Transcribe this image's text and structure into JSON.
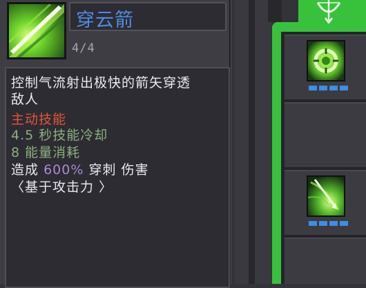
{
  "tooltip": {
    "skill_name": "穿云箭",
    "level": "4/4",
    "description_line1": "控制气流射出极快的箭矢穿透",
    "description_line2": "敌人",
    "skill_type": "主动技能",
    "cooldown": "4.5 秒技能冷却",
    "energy_cost": "8 能量消耗",
    "damage_prefix": "造成",
    "damage_value": "600%",
    "damage_suffix": "穿刺 伤害",
    "damage_basis": "〈基于攻击力 〉"
  },
  "colors": {
    "skill_name": "#4d8ce0",
    "skill_type": "#e1563a",
    "stats": "#8bb07e",
    "damage_value": "#a989d8",
    "panel_accent": "#38c23c",
    "pip": "#3a8fe6"
  },
  "panel": {
    "category_icon": "bow-icon",
    "slots": [
      {
        "icon": "swirl-ring-skill-icon",
        "pips": 4
      },
      {
        "icon": "empty"
      },
      {
        "icon": "piercing-arrow-skill-icon",
        "pips": 4
      },
      {
        "icon": "empty"
      }
    ]
  }
}
